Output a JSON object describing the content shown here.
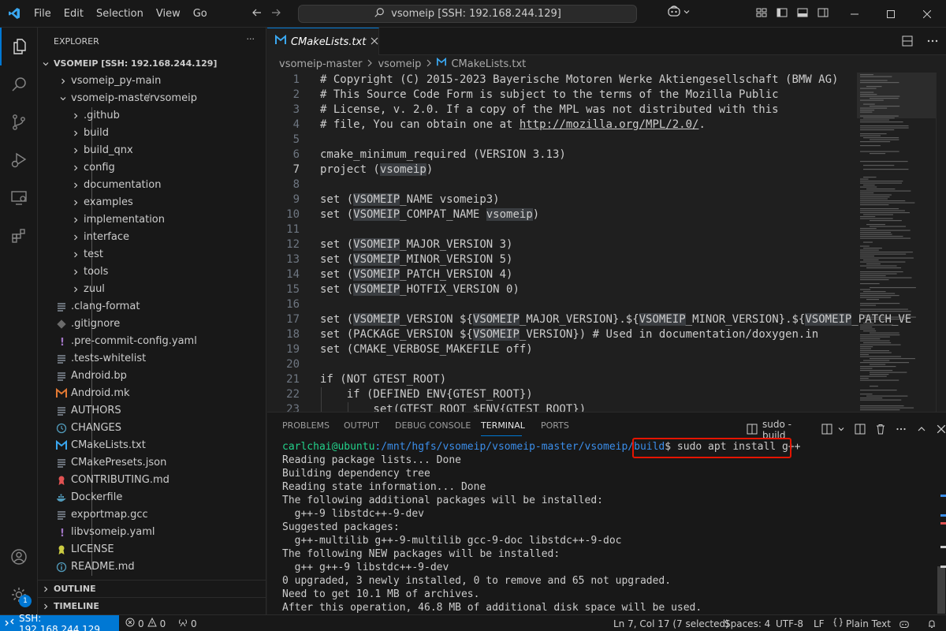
{
  "titlebar": {
    "menus": [
      "File",
      "Edit",
      "Selection",
      "View",
      "Go"
    ],
    "search": "vsomeip [SSH: 192.168.244.129]"
  },
  "activity": {
    "account_badge": "1"
  },
  "explorer": {
    "header": "EXPLORER",
    "more": "···",
    "workspace": "VSOMEIP [SSH: 192.168.244.129]",
    "items": [
      {
        "label": "vsomeip_py-main",
        "kind": "folder",
        "depth": 0,
        "expanded": false
      },
      {
        "label": "vsomeip-master",
        "label2": "vsomeip",
        "kind": "folder",
        "depth": 0,
        "expanded": true
      },
      {
        "label": ".github",
        "kind": "folder",
        "depth": 1
      },
      {
        "label": "build",
        "kind": "folder",
        "depth": 1
      },
      {
        "label": "build_qnx",
        "kind": "folder",
        "depth": 1
      },
      {
        "label": "config",
        "kind": "folder",
        "depth": 1
      },
      {
        "label": "documentation",
        "kind": "folder",
        "depth": 1
      },
      {
        "label": "examples",
        "kind": "folder",
        "depth": 1
      },
      {
        "label": "implementation",
        "kind": "folder",
        "depth": 1
      },
      {
        "label": "interface",
        "kind": "folder",
        "depth": 1
      },
      {
        "label": "test",
        "kind": "folder",
        "depth": 1
      },
      {
        "label": "tools",
        "kind": "folder",
        "depth": 1
      },
      {
        "label": "zuul",
        "kind": "folder",
        "depth": 1
      },
      {
        "label": ".clang-format",
        "kind": "lines",
        "depth": 1
      },
      {
        "label": ".gitignore",
        "kind": "git",
        "depth": 1
      },
      {
        "label": ".pre-commit-config.yaml",
        "kind": "yaml",
        "depth": 1
      },
      {
        "label": ".tests-whitelist",
        "kind": "lines",
        "depth": 1
      },
      {
        "label": "Android.bp",
        "kind": "lines",
        "depth": 1
      },
      {
        "label": "Android.mk",
        "kind": "makefile",
        "depth": 1
      },
      {
        "label": "AUTHORS",
        "kind": "lines",
        "depth": 1
      },
      {
        "label": "CHANGES",
        "kind": "clock",
        "depth": 1
      },
      {
        "label": "CMakeLists.txt",
        "kind": "cmake",
        "depth": 1
      },
      {
        "label": "CMakePresets.json",
        "kind": "lines",
        "depth": 1
      },
      {
        "label": "CONTRIBUTING.md",
        "kind": "ribbon",
        "depth": 1
      },
      {
        "label": "Dockerfile",
        "kind": "docker",
        "depth": 1
      },
      {
        "label": "exportmap.gcc",
        "kind": "lines",
        "depth": 1
      },
      {
        "label": "libvsomeip.yaml",
        "kind": "yaml",
        "depth": 1
      },
      {
        "label": "LICENSE",
        "kind": "license",
        "depth": 1
      },
      {
        "label": "README.md",
        "kind": "info",
        "depth": 1
      }
    ],
    "outline": "OUTLINE",
    "timeline": "TIMELINE"
  },
  "editor": {
    "tab_label": "CMakeLists.txt",
    "breadcrumb": [
      "vsomeip-master",
      "vsomeip",
      "CMakeLists.txt"
    ],
    "current_line": 7,
    "lines": [
      {
        "n": "1",
        "t": "# Copyright (C) 2015-2023 Bayerische Motoren Werke Aktiengesellschaft (BMW AG)"
      },
      {
        "n": "2",
        "t": "# This Source Code Form is subject to the terms of the Mozilla Public"
      },
      {
        "n": "3",
        "t": "# License, v. 2.0. If a copy of the MPL was not distributed with this"
      },
      {
        "n": "4",
        "t": "# file, You can obtain one at ",
        "link": "http://mozilla.org/MPL/2.0/",
        "after": "."
      },
      {
        "n": "5",
        "t": ""
      },
      {
        "n": "6",
        "t": "cmake_minimum_required (VERSION 3.13)"
      },
      {
        "n": "7",
        "t": "project (",
        "hl": "vsomeip",
        "after": ")"
      },
      {
        "n": "8",
        "t": ""
      },
      {
        "n": "9",
        "t": "set (",
        "hl": "VSOMEIP",
        "after": "_NAME vsomeip3)"
      },
      {
        "n": "10",
        "t": "set (",
        "hl": "VSOMEIP",
        "after": "_COMPAT_NAME ",
        "hl2": "vsomeip",
        "after2": ")"
      },
      {
        "n": "11",
        "t": ""
      },
      {
        "n": "12",
        "t": "set (",
        "hl": "VSOMEIP",
        "after": "_MAJOR_VERSION 3)"
      },
      {
        "n": "13",
        "t": "set (",
        "hl": "VSOMEIP",
        "after": "_MINOR_VERSION 5)"
      },
      {
        "n": "14",
        "t": "set (",
        "hl": "VSOMEIP",
        "after": "_PATCH_VERSION 4)"
      },
      {
        "n": "15",
        "t": "set (",
        "hl": "VSOMEIP",
        "after": "_HOTFIX_VERSION 0)"
      },
      {
        "n": "16",
        "t": ""
      },
      {
        "n": "17",
        "t": "set (",
        "hl": "VSOMEIP",
        "after": "_VERSION ${",
        "hl2": "VSOMEIP",
        "after2": "_MAJOR_VERSION}.${",
        "hl3": "VSOMEIP",
        "after3": "_MINOR_VERSION}.${",
        "hl4": "VSOMEIP",
        "after4": "_PATCH_VE"
      },
      {
        "n": "18",
        "t": "set (PACKAGE_VERSION ${",
        "hl": "VSOMEIP",
        "after": "_VERSION}) # Used in documentation/doxygen.in"
      },
      {
        "n": "19",
        "t": "set (CMAKE_VERBOSE_MAKEFILE off)"
      },
      {
        "n": "20",
        "t": ""
      },
      {
        "n": "21",
        "t": "if (NOT GTEST_ROOT)"
      },
      {
        "n": "22",
        "t": "    if (DEFINED ENV{GTEST_ROOT})"
      },
      {
        "n": "23",
        "t": "        set(GTEST_ROOT $ENV{GTEST_ROOT})"
      }
    ]
  },
  "panel": {
    "tabs": [
      "PROBLEMS",
      "OUTPUT",
      "DEBUG CONSOLE",
      "TERMINAL",
      "PORTS"
    ],
    "active_tab": "TERMINAL",
    "terminal_name": "sudo - build",
    "prompt_user": "carlchai@ubuntu",
    "prompt_path": ":/mnt/hgfs/vsomeip/vsomeip-master/vsomeip/build",
    "prompt_sym": "$",
    "command": " sudo apt install g++",
    "output": [
      "Reading package lists... Done",
      "Building dependency tree",
      "Reading state information... Done",
      "The following additional packages will be installed:",
      "  g++-9 libstdc++-9-dev",
      "Suggested packages:",
      "  g++-multilib g++-9-multilib gcc-9-doc libstdc++-9-doc",
      "The following NEW packages will be installed:",
      "  g++ g++-9 libstdc++-9-dev",
      "0 upgraded, 3 newly installed, 0 to remove and 65 not upgraded.",
      "Need to get 10.1 MB of archives.",
      "After this operation, 46.8 MB of additional disk space will be used."
    ],
    "highlight_color": "#e51400"
  },
  "statusbar": {
    "remote": "SSH: 192.168.244.129",
    "errors": "0",
    "warnings": "0",
    "ports": "0",
    "position": "Ln 7, Col 17 (7 selected)",
    "spaces": "Spaces: 4",
    "encoding": "UTF-8",
    "eol": "LF",
    "language": "Plain Text"
  },
  "colors": {
    "accent": "#0078d4",
    "background": "#1f1f1f",
    "terminal_user": "#23d18b",
    "terminal_path": "#3b8eea"
  }
}
